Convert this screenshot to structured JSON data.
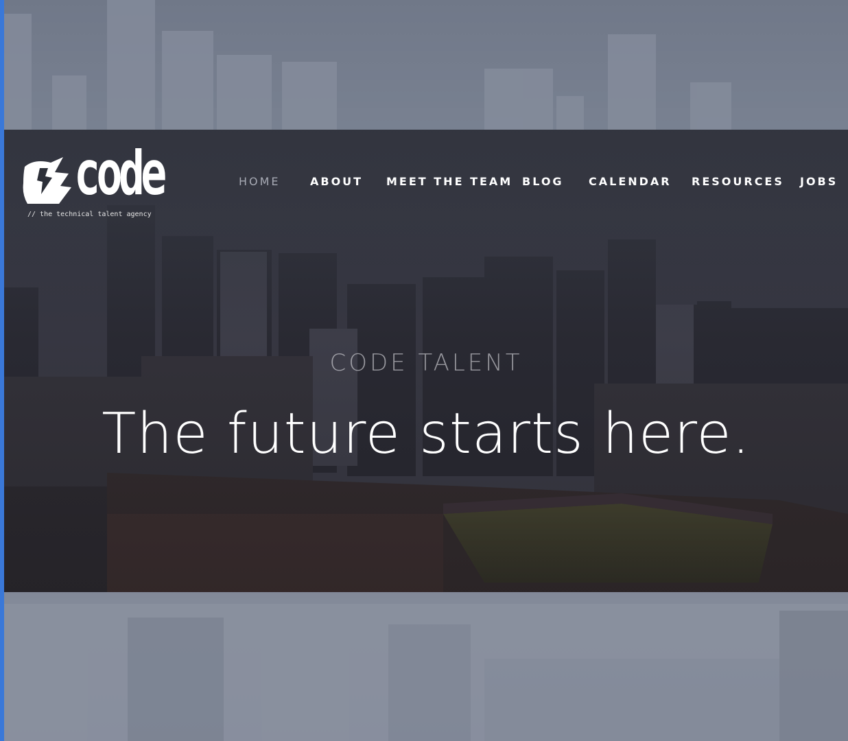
{
  "brand": {
    "wordmark": "code",
    "tagline": "// the technical talent agency"
  },
  "nav": {
    "items": [
      {
        "label": "HOME",
        "active": true
      },
      {
        "label": "ABOUT",
        "active": false
      },
      {
        "label": "MEET THE TEAM",
        "active": false
      },
      {
        "label": "BLOG",
        "active": false
      },
      {
        "label": "CALENDAR",
        "active": false
      },
      {
        "label": "RESOURCES",
        "active": false
      },
      {
        "label": "JOBS",
        "active": false
      }
    ]
  },
  "hero": {
    "kicker": "CODE TALENT",
    "headline": "The future starts here."
  },
  "colors": {
    "accent_bar": "#3a78d8",
    "nav_active": "#a7aab4",
    "text": "#ffffff"
  }
}
